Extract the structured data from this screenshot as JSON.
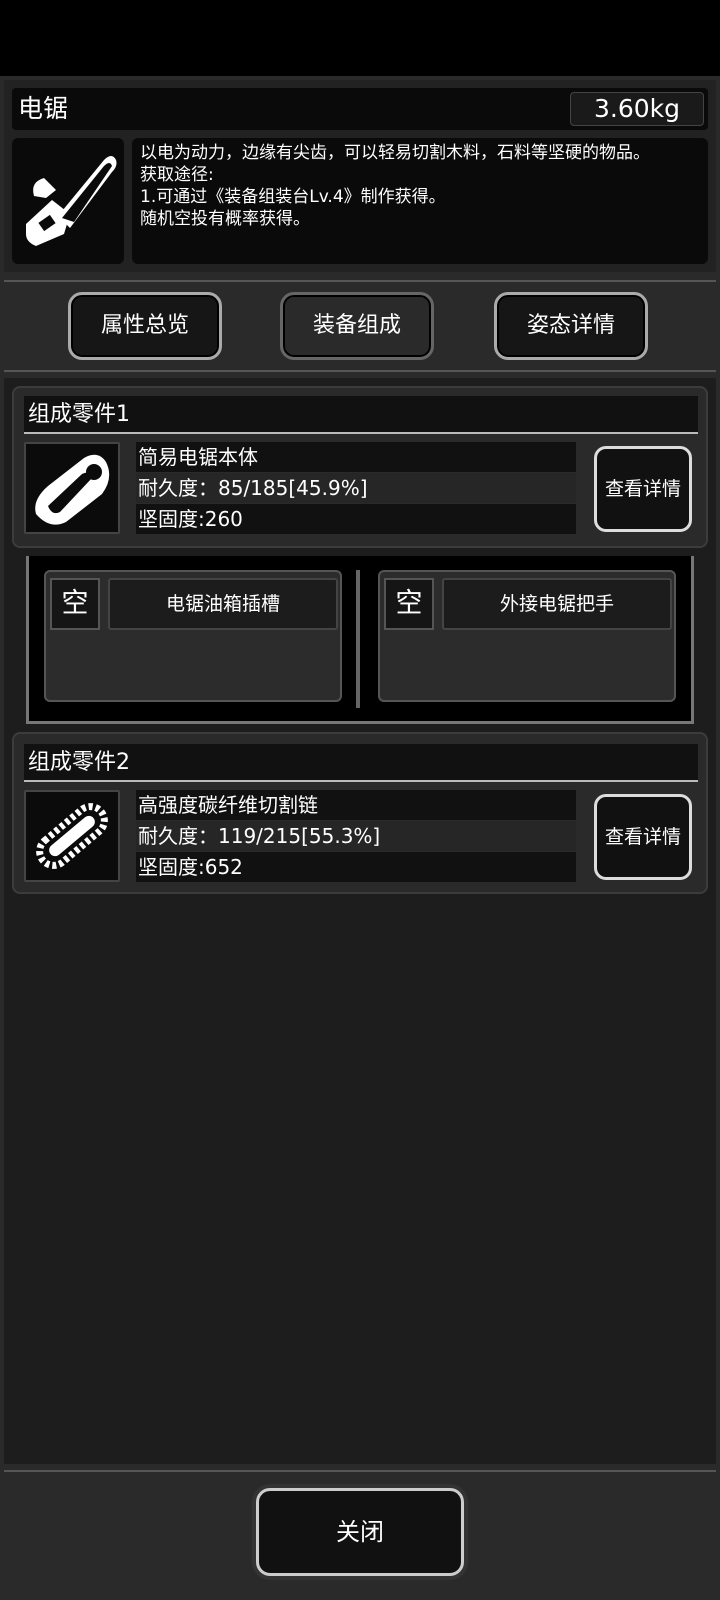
{
  "item": {
    "title": "电锯",
    "weight": "3.60kg",
    "description": "以电为动力，边缘有尖齿，可以轻易切割木料，石料等坚硬的物品。\n获取途径:\n1.可通过《装备组装台Lv.4》制作获得。\n随机空投有概率获得。",
    "icon": "chainsaw-icon"
  },
  "tabs": [
    {
      "label": "属性总览"
    },
    {
      "label": "装备组成"
    },
    {
      "label": "姿态详情"
    }
  ],
  "parts": [
    {
      "section_title": "组成零件1",
      "name": "简易电锯本体",
      "durability": "耐久度：85/185[45.9%]",
      "hardness": "坚固度:260",
      "detail_label": "查看详情",
      "icon": "chainsaw-body-icon"
    },
    {
      "section_title": "组成零件2",
      "name": "高强度碳纤维切割链",
      "durability": "耐久度：119/215[55.3%]",
      "hardness": "坚固度:652",
      "detail_label": "查看详情",
      "icon": "chain-blade-icon"
    }
  ],
  "slots": [
    {
      "status": "空",
      "label": "电锯油箱插槽"
    },
    {
      "status": "空",
      "label": "外接电锯把手"
    }
  ],
  "close_label": "关闭"
}
